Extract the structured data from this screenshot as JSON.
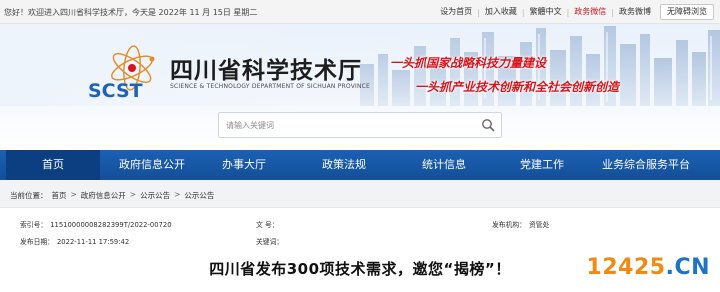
{
  "topbar": {
    "welcome": "您好！欢迎进入四川省科学技术厅，今天是  2022年 11 月 15日  星期二",
    "links": [
      "设为首页",
      "加入收藏",
      "繁體中文",
      "政务微信",
      "政务微博"
    ],
    "access_button": "无障碍浏览"
  },
  "banner": {
    "title": "四川省科学技术厅",
    "subtitle": "SCIENCE & TECHNOLOGY DEPARTMENT OF SICHUAN PROVINCE",
    "logo_text": "SCST",
    "slogan_1": "一头抓国家战略科技力量建设",
    "slogan_2": "一头抓产业技术创新和全社会创新创造"
  },
  "search": {
    "placeholder": "请输入关键词",
    "value": ""
  },
  "nav": {
    "items": [
      "首页",
      "政府信息公开",
      "办事大厅",
      "政策法规",
      "统计信息",
      "党建工作",
      "业务综合服务平台"
    ],
    "active_index": 0
  },
  "breadcrumb": {
    "label": "当前位置：",
    "items": [
      "首页",
      "政府信息公开",
      "公示公告",
      "公示公告"
    ],
    "separator": ">"
  },
  "meta": {
    "index_label": "索引号：",
    "index_value": "11510000008282399T/2022-00720",
    "doc_label": "文    号：",
    "doc_value": "",
    "org_label": "发布机构：",
    "org_value": "资管处",
    "date_label": "发布日期：",
    "date_value": "2022-11-11 17:59:42",
    "keyword_label": "关键词：",
    "keyword_value": ""
  },
  "article": {
    "title": "四川省发布300项技术需求，邀您“揭榜”！"
  },
  "watermark": {
    "number": "12425",
    "dot": ".",
    "tld": "CN"
  },
  "colors": {
    "nav_blue": "#1b60b3",
    "nav_active": "#0b3f82",
    "slogan_red": "#d7141c",
    "watermark_orange": "#f08a12",
    "watermark_blue": "#1f73c7"
  }
}
